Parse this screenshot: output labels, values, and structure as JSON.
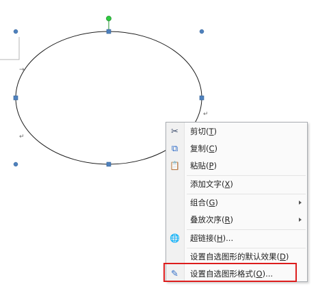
{
  "marks": {
    "paragraph": "↵",
    "arrow": "→"
  },
  "context_menu": {
    "items": [
      {
        "id": "cut",
        "label": "剪切",
        "mnemonic": "T",
        "icon": "scissors-icon",
        "glyph": "✂",
        "has_submenu": false
      },
      {
        "id": "copy",
        "label": "复制",
        "mnemonic": "C",
        "icon": "copy-icon",
        "glyph": "⧉",
        "has_submenu": false
      },
      {
        "id": "paste",
        "label": "粘贴",
        "mnemonic": "P",
        "icon": "paste-icon",
        "glyph": "📋",
        "has_submenu": false
      },
      {
        "id": "add-text",
        "label": "添加文字",
        "mnemonic": "X",
        "icon": "",
        "glyph": "",
        "has_submenu": false
      },
      {
        "id": "group",
        "label": "组合",
        "mnemonic": "G",
        "icon": "",
        "glyph": "",
        "has_submenu": true
      },
      {
        "id": "order",
        "label": "叠放次序",
        "mnemonic": "R",
        "icon": "",
        "glyph": "",
        "has_submenu": true
      },
      {
        "id": "hyperlink",
        "label": "超链接",
        "mnemonic": "H",
        "suffix": "...",
        "icon": "hyperlink-globe-icon",
        "glyph": "🌐",
        "has_submenu": false
      },
      {
        "id": "set-default",
        "label": "设置自选图形的默认效果",
        "mnemonic": "D",
        "icon": "",
        "glyph": "",
        "has_submenu": false
      },
      {
        "id": "format-shape",
        "label": "设置自选图形格式",
        "mnemonic": "O",
        "suffix": "...",
        "icon": "format-shape-icon",
        "glyph": "✎",
        "has_submenu": false
      }
    ]
  },
  "colors": {
    "highlight": "#dd1c1c",
    "handle": "#4f81bd",
    "rotation_handle": "#2ecc40"
  }
}
